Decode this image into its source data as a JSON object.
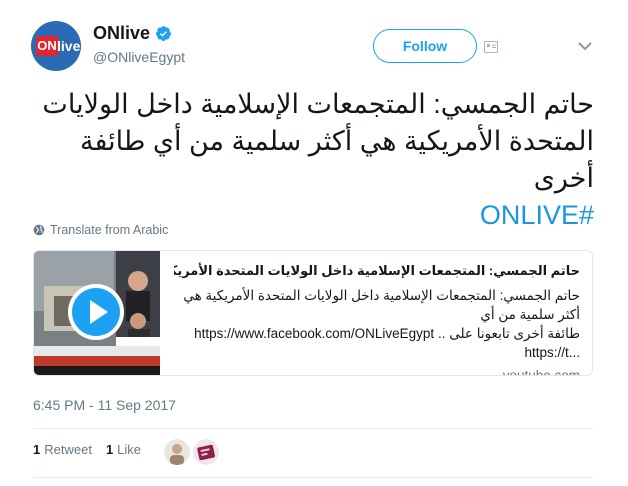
{
  "author": {
    "avatar_text_on": "ON",
    "avatar_text_live": "live",
    "name": "ONlive",
    "handle": "@ONliveEgypt",
    "verified": true
  },
  "actions": {
    "follow_label": "Follow"
  },
  "tweet": {
    "text": "حاتم الجمسي: المتجمعات الإسلامية داخل الولايات المتحدة الأمريكية هي أكثر سلمية من أي طائفة أخرى",
    "hashtag": "#ONLIVE",
    "translate_label": "Translate from Arabic"
  },
  "card": {
    "title": "حاتم الجمسي: المتجمعات الإسلامية داخل الولايات المتحدة الأمريكية هي...",
    "desc_line1": "حاتم الجمسي: المتجمعات الإسلامية داخل الولايات المتحدة الأمريكية هي أكثر سلمية من أي",
    "desc_line2_ar": "طائفة أخرى تابعونا على ..",
    "desc_line2_url": "https://www.facebook.com/ONLiveEgypt",
    "desc_line3": "https://t...",
    "domain": "youtube.com"
  },
  "meta": {
    "timestamp": "6:45 PM - 11 Sep 2017",
    "retweets_count": "1",
    "retweets_label": "Retweet",
    "likes_count": "1",
    "likes_label": "Like"
  },
  "colors": {
    "accent": "#1da1f2",
    "hashtag": "#1b95e0",
    "secondary_text": "#657786",
    "border": "#e1e8ed"
  }
}
